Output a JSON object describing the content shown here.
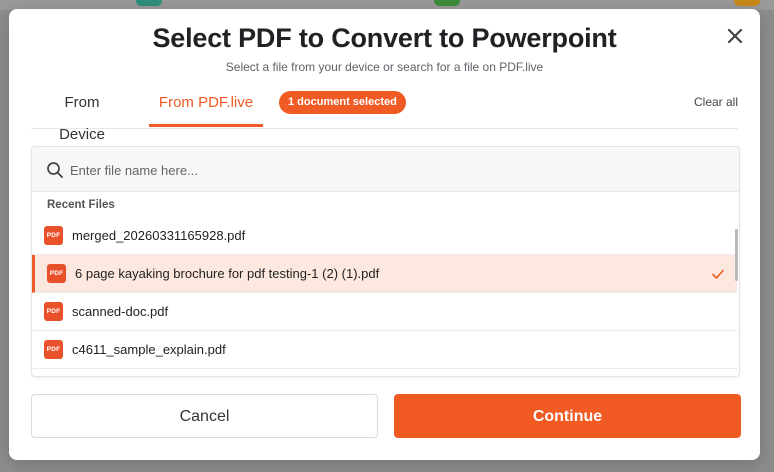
{
  "modal": {
    "title": "Select PDF to Convert to Powerpoint",
    "subtitle": "Select a file from your device or search for a file on PDF.live"
  },
  "tabs": [
    {
      "label": "From Device",
      "active": false
    },
    {
      "label": "From PDF.live",
      "active": true
    }
  ],
  "badge": {
    "label": "1 document selected"
  },
  "clear_all": {
    "label": "Clear all"
  },
  "search": {
    "placeholder": "Enter file name here..."
  },
  "recent_files": {
    "heading": "Recent Files",
    "files": [
      {
        "name": "merged_20260331165928.pdf",
        "icon": "pdf-icon",
        "icon_text": "PDF",
        "selected": false
      },
      {
        "name": "6 page kayaking brochure for pdf testing-1 (2) (1).pdf",
        "icon": "pdf-icon",
        "icon_text": "PDF",
        "selected": true
      },
      {
        "name": "scanned-doc.pdf",
        "icon": "pdf-icon",
        "icon_text": "PDF",
        "selected": false
      },
      {
        "name": "c4611_sample_explain.pdf",
        "icon": "pdf-icon",
        "icon_text": "PDF",
        "selected": false
      }
    ]
  },
  "buttons": {
    "cancel": "Cancel",
    "continue": "Continue"
  },
  "colors": {
    "accent": "#f05a24",
    "selected_row_bg": "#fde8df"
  }
}
